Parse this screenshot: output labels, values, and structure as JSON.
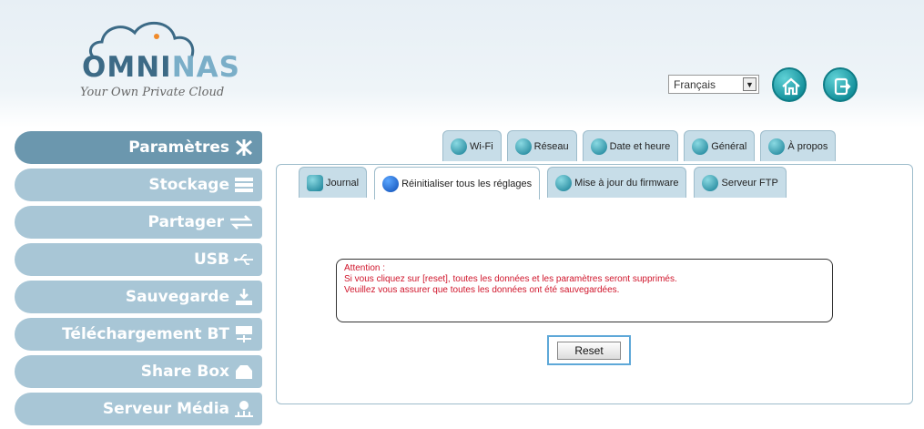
{
  "brand": {
    "name_main": "OMNI",
    "name_accent": "NAS",
    "tagline": "Your Own Private Cloud"
  },
  "header": {
    "language": "Français"
  },
  "sidebar": {
    "items": [
      {
        "label": "Paramètres"
      },
      {
        "label": "Stockage"
      },
      {
        "label": "Partager"
      },
      {
        "label": "USB"
      },
      {
        "label": "Sauvegarde"
      },
      {
        "label": "Téléchargement BT"
      },
      {
        "label": "Share Box"
      },
      {
        "label": "Serveur Média"
      }
    ]
  },
  "tabs_top": [
    {
      "label": "Wi-Fi"
    },
    {
      "label": "Réseau"
    },
    {
      "label": "Date et heure"
    },
    {
      "label": "Général"
    },
    {
      "label": "À propos"
    }
  ],
  "tabs_sub": [
    {
      "label": "Journal"
    },
    {
      "label": "Réinitialiser tous les réglages"
    },
    {
      "label": "Mise à jour du firmware"
    },
    {
      "label": "Serveur FTP"
    }
  ],
  "warning": {
    "line1": "Attention :",
    "line2": "Si vous cliquez sur [reset], toutes les données et les paramètres seront supprimés.",
    "line3": "Veuillez vous assurer que toutes les données ont été sauvegardées."
  },
  "reset_label": "Reset",
  "colors": {
    "sidebar_active": "#6b97ae",
    "sidebar_item": "#a8c6d6",
    "tab_bg": "#c7dde8",
    "warning_text": "#d0152b",
    "reset_highlight": "#5ea8d8"
  }
}
